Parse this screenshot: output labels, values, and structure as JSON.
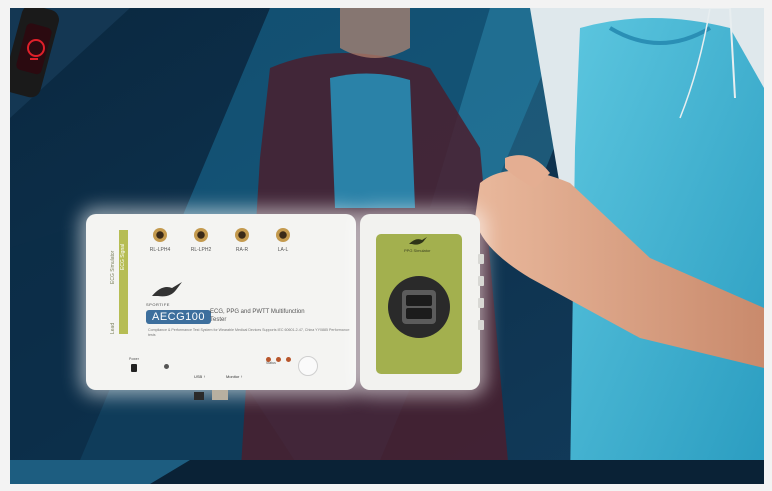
{
  "scene": {
    "description_colors": {
      "navy": "#0c2c46",
      "teal": "#2a8fb5",
      "cyan_shirt": "#3fb5d4",
      "device_green": "#a3b04e",
      "model_blue": "#3d6f9d"
    }
  },
  "device": {
    "jacks": [
      "RL-LPH4",
      "RL-LPH2",
      "RA-R",
      "LA-L"
    ],
    "side_labels": [
      "ECG Simulator",
      "ECG Signal",
      "Lead"
    ],
    "brand": "SPORTIFE",
    "model": "AECG100",
    "title": "ECG, PPG and PWTT Multifunction Tester",
    "description": "Compliance & Performance Test System for Wearable Medical Devices Supports IEC 60601-2-47, China YY0885 Performance tests",
    "switch_label": "Power",
    "usb_label": "USB ↑",
    "monitor_label": "Monitor ↑",
    "status_label": "Status"
  },
  "sensor_panel": {
    "logo": "PPG Simulator",
    "icons": [
      "bird-logo-icon",
      "ppg-sensor-icon"
    ]
  }
}
